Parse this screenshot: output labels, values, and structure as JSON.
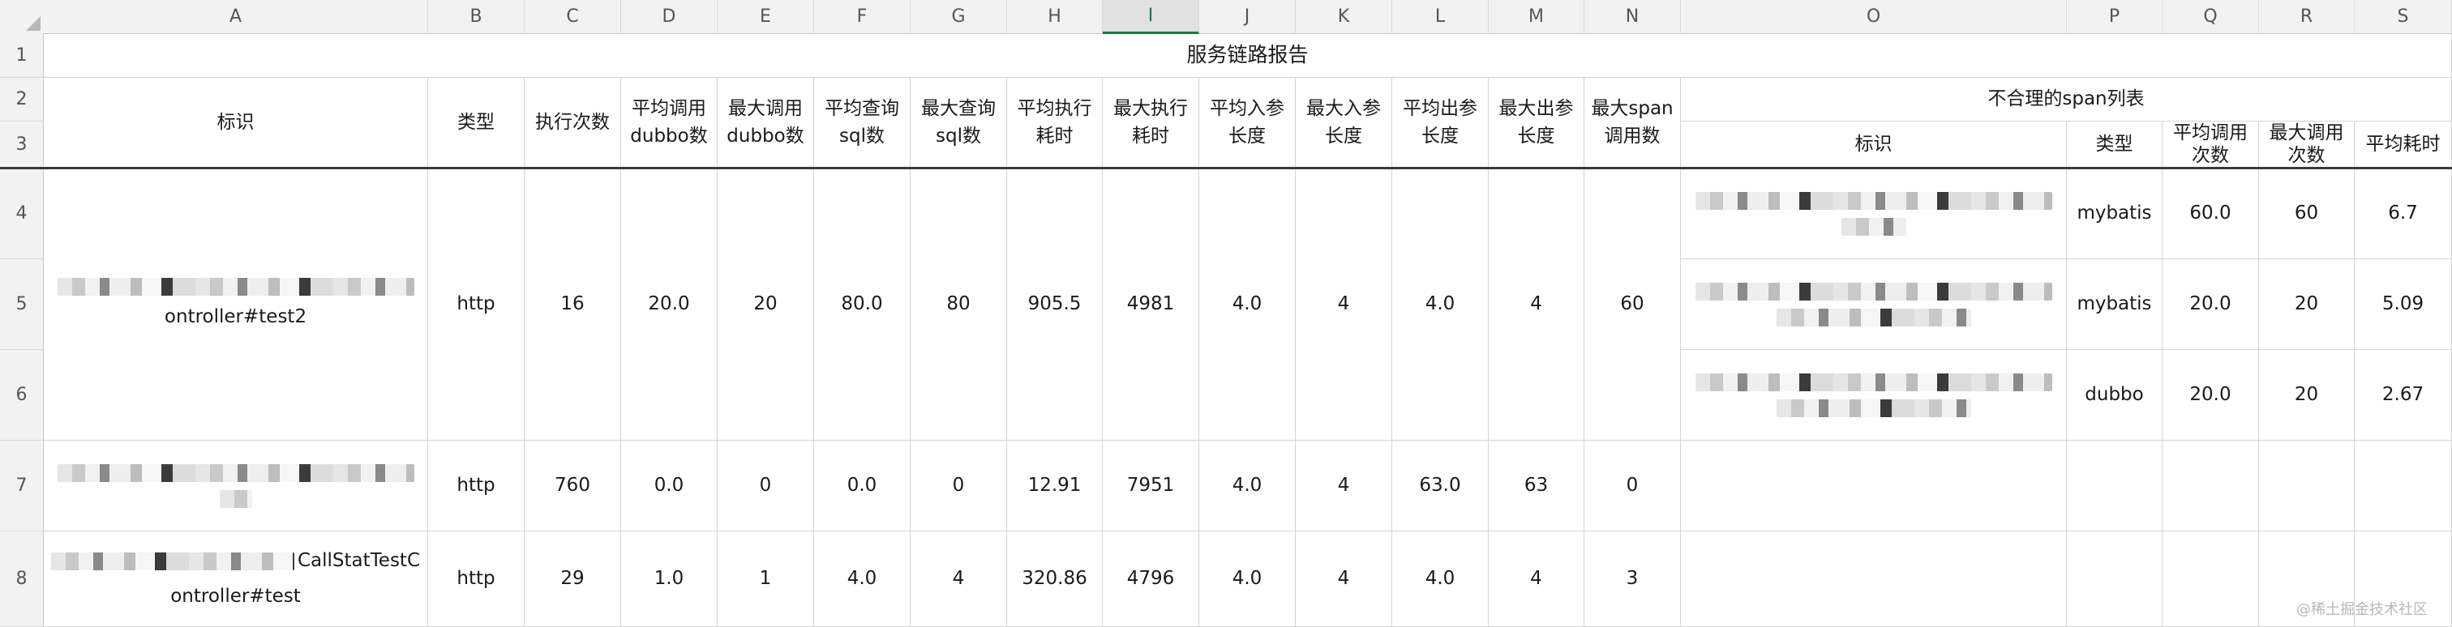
{
  "columns": [
    "A",
    "B",
    "C",
    "D",
    "E",
    "F",
    "G",
    "H",
    "I",
    "J",
    "K",
    "L",
    "M",
    "N",
    "O",
    "P",
    "Q",
    "R",
    "S"
  ],
  "rows": [
    "1",
    "2",
    "3",
    "4",
    "5",
    "6",
    "7",
    "8"
  ],
  "title": "服务链路报告",
  "headers": {
    "identifier": "标识",
    "type": "类型",
    "exec_count": "执行次数",
    "avg_dubbo": "平均调用dubbo数",
    "max_dubbo": "最大调用dubbo数",
    "avg_sql": "平均查询sql数",
    "max_sql": "最大查询sql数",
    "avg_time": "平均执行耗时",
    "max_time": "最大执行耗时",
    "avg_in": "平均入参长度",
    "max_in": "最大入参长度",
    "avg_out": "平均出参长度",
    "max_out": "最大出参长度",
    "max_span": "最大span调用数",
    "span_group": "不合理的span列表",
    "span_identifier": "标识",
    "span_type": "类型",
    "span_avg_calls": "平均调用次数",
    "span_max_calls": "最大调用次数",
    "span_avg_time": "平均耗时"
  },
  "records": [
    {
      "ident_tail": "ontroller#test2",
      "type": "http",
      "exec": "16",
      "avg_dubbo": "20.0",
      "max_dubbo": "20",
      "avg_sql": "80.0",
      "max_sql": "80",
      "avg_time": "905.5",
      "max_time": "4981",
      "avg_in": "4.0",
      "max_in": "4",
      "avg_out": "4.0",
      "max_out": "4",
      "max_span": "60"
    },
    {
      "ident_tail": "",
      "type": "http",
      "exec": "760",
      "avg_dubbo": "0.0",
      "max_dubbo": "0",
      "avg_sql": "0.0",
      "max_sql": "0",
      "avg_time": "12.91",
      "max_time": "7951",
      "avg_in": "4.0",
      "max_in": "4",
      "avg_out": "63.0",
      "max_out": "63",
      "max_span": "0"
    },
    {
      "ident_mid": "CallStatTestC",
      "ident_tail": "ontroller#test",
      "type": "http",
      "exec": "29",
      "avg_dubbo": "1.0",
      "max_dubbo": "1",
      "avg_sql": "4.0",
      "max_sql": "4",
      "avg_time": "320.86",
      "max_time": "4796",
      "avg_in": "4.0",
      "max_in": "4",
      "avg_out": "4.0",
      "max_out": "4",
      "max_span": "3"
    }
  ],
  "spans": [
    {
      "type": "mybatis",
      "avg_calls": "60.0",
      "max_calls": "60",
      "avg_time": "6.7"
    },
    {
      "type": "mybatis",
      "avg_calls": "20.0",
      "max_calls": "20",
      "avg_time": "5.09"
    },
    {
      "type": "dubbo",
      "avg_calls": "20.0",
      "max_calls": "20",
      "avg_time": "2.67"
    }
  ],
  "watermark": "@稀土掘金技术社区"
}
